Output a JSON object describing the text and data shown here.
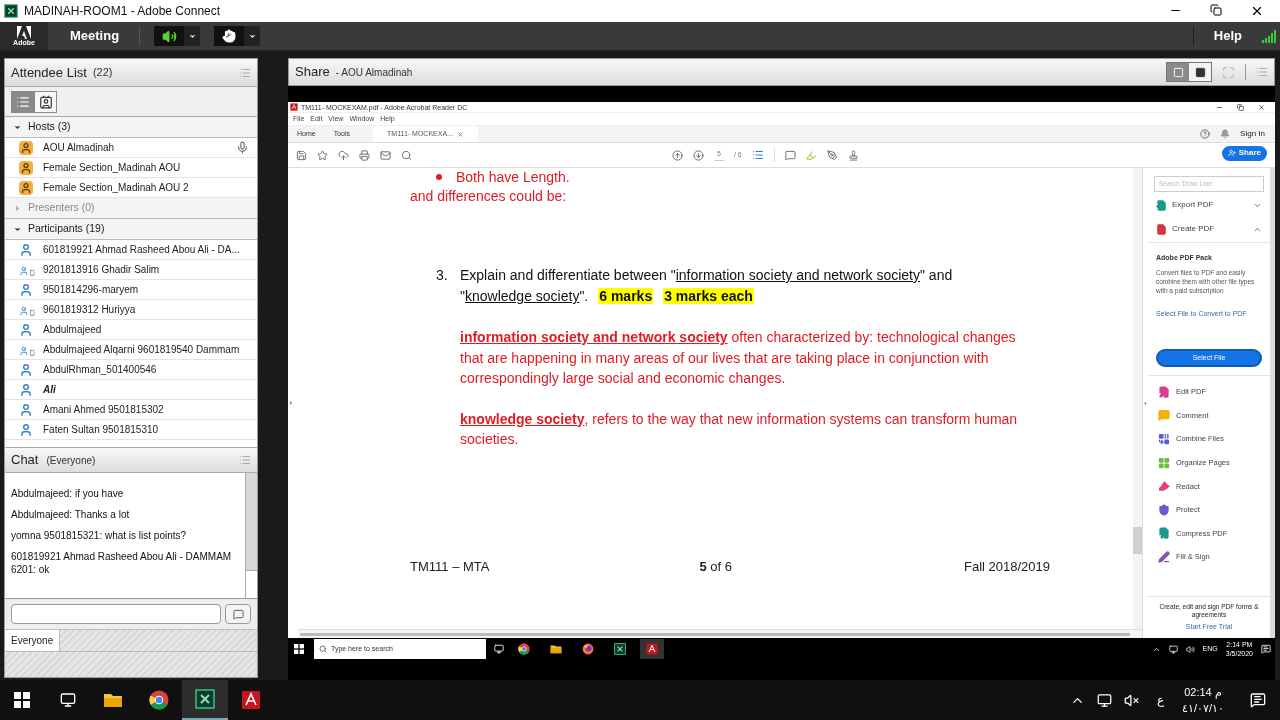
{
  "window": {
    "title": "MADINAH-ROOM1 - Adobe Connect"
  },
  "app_bar": {
    "logo": "Adobe",
    "menu": "Meeting",
    "speaker_on": true,
    "help": "Help"
  },
  "attendee_list": {
    "title": "Attendee List",
    "count": "(22)",
    "view_tabs": [
      {
        "selected": true
      },
      {
        "selected": false
      }
    ],
    "groups": [
      {
        "label": "Hosts (3)",
        "expanded": true,
        "people": [
          {
            "name": "AOU  Almadinah",
            "kind": "host",
            "italic": false,
            "speaking": true
          },
          {
            "name": "Female Section_Madinah AOU",
            "kind": "host",
            "italic": false,
            "speaking": false
          },
          {
            "name": "Female Section_Madinah AOU 2",
            "kind": "host",
            "italic": false,
            "speaking": false
          }
        ]
      },
      {
        "label": "Presenters (0)",
        "expanded": false
      },
      {
        "label": "Participants (19)",
        "expanded": true,
        "people": [
          {
            "name": "601819921 Ahmad Rasheed Abou Ali - DA...",
            "kind": "desktop",
            "italic": false,
            "speaking": false
          },
          {
            "name": "9201813916 Ghadir Salim",
            "kind": "device",
            "italic": false,
            "speaking": false
          },
          {
            "name": "9501814296-maryem",
            "kind": "desktop",
            "italic": false,
            "speaking": false
          },
          {
            "name": "9601819312 Huriyya",
            "kind": "device",
            "italic": false,
            "speaking": false
          },
          {
            "name": "Abdulmajeed",
            "kind": "desktop",
            "italic": false,
            "speaking": false
          },
          {
            "name": "Abdulmajeed Alqarni 9601819540 Dammam",
            "kind": "device",
            "italic": false,
            "speaking": false
          },
          {
            "name": "AbdulRhman_501400546",
            "kind": "desktop",
            "italic": false,
            "speaking": false
          },
          {
            "name": "Ali",
            "kind": "desktop",
            "italic": true,
            "speaking": false
          },
          {
            "name": "Amani Ahmed 9501815302",
            "kind": "desktop",
            "italic": false,
            "speaking": false
          },
          {
            "name": "Faten Sultan 9501815310",
            "kind": "desktop",
            "italic": false,
            "speaking": false
          }
        ]
      }
    ]
  },
  "chat": {
    "title": "Chat",
    "audience": "(Everyone)",
    "messages": [
      {
        "sender": "Abdulmajeed:",
        "text": "if you have"
      },
      {
        "sender": "Abdulmajeed:",
        "text": "Thanks a lot"
      },
      {
        "sender": "yomna 9501815321:",
        "text": "what is list points?"
      },
      {
        "sender": "601819921 Ahmad Rasheed Abou Ali - DAMMAM 6201:",
        "text": "ok"
      }
    ],
    "recipient_tab": "Everyone"
  },
  "share": {
    "title": "Share",
    "presenter": "- AOU  Almadinah",
    "acrobat": {
      "title": "TM111- MOCKEXAM.pdf - Adobe Acrobat Reader DC",
      "menu": [
        "File",
        "Edit",
        "View",
        "Window",
        "Help"
      ],
      "tabs": [
        {
          "label": "Home",
          "selected": false
        },
        {
          "label": "Tools",
          "selected": false
        },
        {
          "label": "TM111- MOCKEXA...",
          "selected": true
        }
      ],
      "page": "5",
      "page_total": "/ 6",
      "sign_in": "Sign In",
      "share_button": "Share",
      "document": {
        "bullet": "Both have Length.",
        "lead": "and differences could be:",
        "question": {
          "number": "3.",
          "segments": [
            {
              "kind": "plain",
              "text": "Explain and differentiate between \""
            },
            {
              "kind": "underline",
              "text": "information society and network society"
            },
            {
              "kind": "plain",
              "text": "\" and \""
            },
            {
              "kind": "underline",
              "text": "knowledge society"
            },
            {
              "kind": "plain",
              "text": "\"."
            },
            {
              "kind": "highlight",
              "text": "6 marks"
            },
            {
              "kind": "highlight",
              "text": "3 marks each"
            }
          ]
        },
        "answers": [
          {
            "term": "information society and network society",
            "text": " often characterized by: technological changes that are happening in many areas of our lives that are taking place in conjunction with correspondingly large social and economic changes."
          },
          {
            "term": "knowledge society",
            "text": ", refers to the way that new information systems can transform human societies."
          }
        ],
        "footer": {
          "left": "TM111 – MTA",
          "center": "**5** of 6",
          "right": "Fall 2018/2019"
        }
      },
      "tools_pane": {
        "search_placeholder": "Search 'Draw Line'",
        "top_tools": [
          {
            "label": "Export PDF",
            "expanded": false,
            "color": "#1a9a8a"
          },
          {
            "label": "Create PDF",
            "expanded": true,
            "color": "#d8343f"
          }
        ],
        "pack": {
          "title": "Adobe PDF Pack",
          "description": "Convert files to PDF and easily combine them with other file types with a paid subscription",
          "link": "Select File to Convert to PDF",
          "button": "Select File"
        },
        "tools": [
          {
            "label": "Edit PDF",
            "kind": "edit",
            "color": "#d6408f"
          },
          {
            "label": "Comment",
            "kind": "comment",
            "color": "#f2b400"
          },
          {
            "label": "Combine Files",
            "kind": "combine",
            "color": "#5b5bd6"
          },
          {
            "label": "Organize Pages",
            "kind": "organize",
            "color": "#6bbf3a"
          },
          {
            "label": "Redact",
            "kind": "redact",
            "color": "#e0407a"
          },
          {
            "label": "Protect",
            "kind": "protect",
            "color": "#6a5acd"
          },
          {
            "label": "Compress PDF",
            "kind": "compress",
            "color": "#1a9a8a"
          },
          {
            "label": "Fill & Sign",
            "kind": "sign",
            "color": "#8a4fbf"
          }
        ],
        "footer": "Create, edit and sign PDF forms & agreements",
        "trial": "Start Free Trial"
      }
    },
    "inner_taskbar": {
      "search_placeholder": "Type here to search",
      "apps": [
        {
          "kind": "chrome",
          "selected": false
        },
        {
          "kind": "folder",
          "selected": false
        },
        {
          "kind": "firefox",
          "selected": false
        },
        {
          "kind": "connect",
          "selected": false
        },
        {
          "kind": "acrobat",
          "selected": true
        }
      ],
      "language": "ENG",
      "time": "2:14 PM",
      "date": "3/5/2020"
    }
  },
  "taskbar": {
    "apps": [
      {
        "kind": "folder",
        "selected": false
      },
      {
        "kind": "chrome",
        "selected": false
      },
      {
        "kind": "connect",
        "selected": true
      },
      {
        "kind": "acrobat",
        "selected": false
      }
    ],
    "language": "ع",
    "time": "02:14 م",
    "date": "٤١/٠٧/١٠"
  }
}
